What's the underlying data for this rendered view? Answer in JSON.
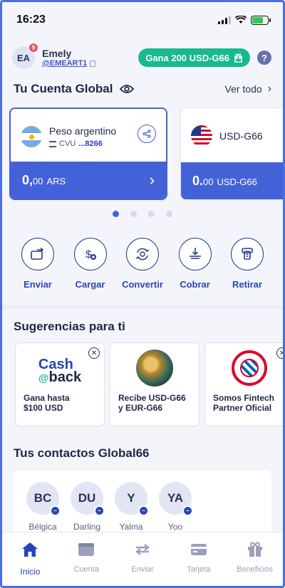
{
  "status_bar": {
    "time": "16:23"
  },
  "user": {
    "initials": "EA",
    "notification_count": "9",
    "name": "Emely",
    "handle": "@EMEART1"
  },
  "promo_button": {
    "label": "Gana 200 USD-G66"
  },
  "help_button": {
    "label": "?"
  },
  "account": {
    "title": "Tu Cuenta Global",
    "see_all": "Ver todo",
    "cards": [
      {
        "name": "Peso argentino",
        "cvu_label": "CVU",
        "cvu_value": "...8266",
        "amount_main": "0,",
        "amount_dec": "00",
        "currency": "ARS",
        "flag": "argentina-flag-icon"
      },
      {
        "name": "USD-G66",
        "amount_main": "0.",
        "amount_dec": "00",
        "currency": "USD-G66",
        "flag": "usa-flag-icon"
      }
    ],
    "carousel_pages": 4,
    "carousel_active": 1
  },
  "actions": [
    {
      "label": "Enviar",
      "icon": "send-icon"
    },
    {
      "label": "Cargar",
      "icon": "load-money-icon"
    },
    {
      "label": "Convertir",
      "icon": "convert-icon"
    },
    {
      "label": "Cobrar",
      "icon": "collect-icon"
    },
    {
      "label": "Retirar",
      "icon": "withdraw-icon"
    }
  ],
  "suggestions": {
    "title": "Sugerencias para ti",
    "items": [
      {
        "line1": "Gana hasta",
        "line2": "$100 USD",
        "image_text_1": "Cash",
        "image_text_2": "back",
        "image_text_2_prefix": "@"
      },
      {
        "line1": "Recibe USD-G66",
        "line2": "y EUR-G66"
      },
      {
        "line1": "Somos Fintech",
        "line2": "Partner Oficial"
      }
    ]
  },
  "contacts": {
    "title": "Tus contactos Global66",
    "items": [
      {
        "initials": "BC",
        "name": "Bélgica"
      },
      {
        "initials": "DU",
        "name": "Darling"
      },
      {
        "initials": "Y",
        "name": "Yalma"
      },
      {
        "initials": "YA",
        "name": "Yoo"
      }
    ]
  },
  "tabbar": [
    {
      "label": "Inicio",
      "icon": "home-icon",
      "active": true
    },
    {
      "label": "Cuenta",
      "icon": "wallet-icon",
      "active": false
    },
    {
      "label": "Enviar",
      "icon": "transfer-arrows-icon",
      "active": false
    },
    {
      "label": "Tarjeta",
      "icon": "card-icon",
      "active": false
    },
    {
      "label": "Beneficios",
      "icon": "gift-icon",
      "active": false
    }
  ],
  "colors": {
    "primary": "#4462d8",
    "accent_green": "#18b98a",
    "badge_red": "#e84a5f"
  }
}
